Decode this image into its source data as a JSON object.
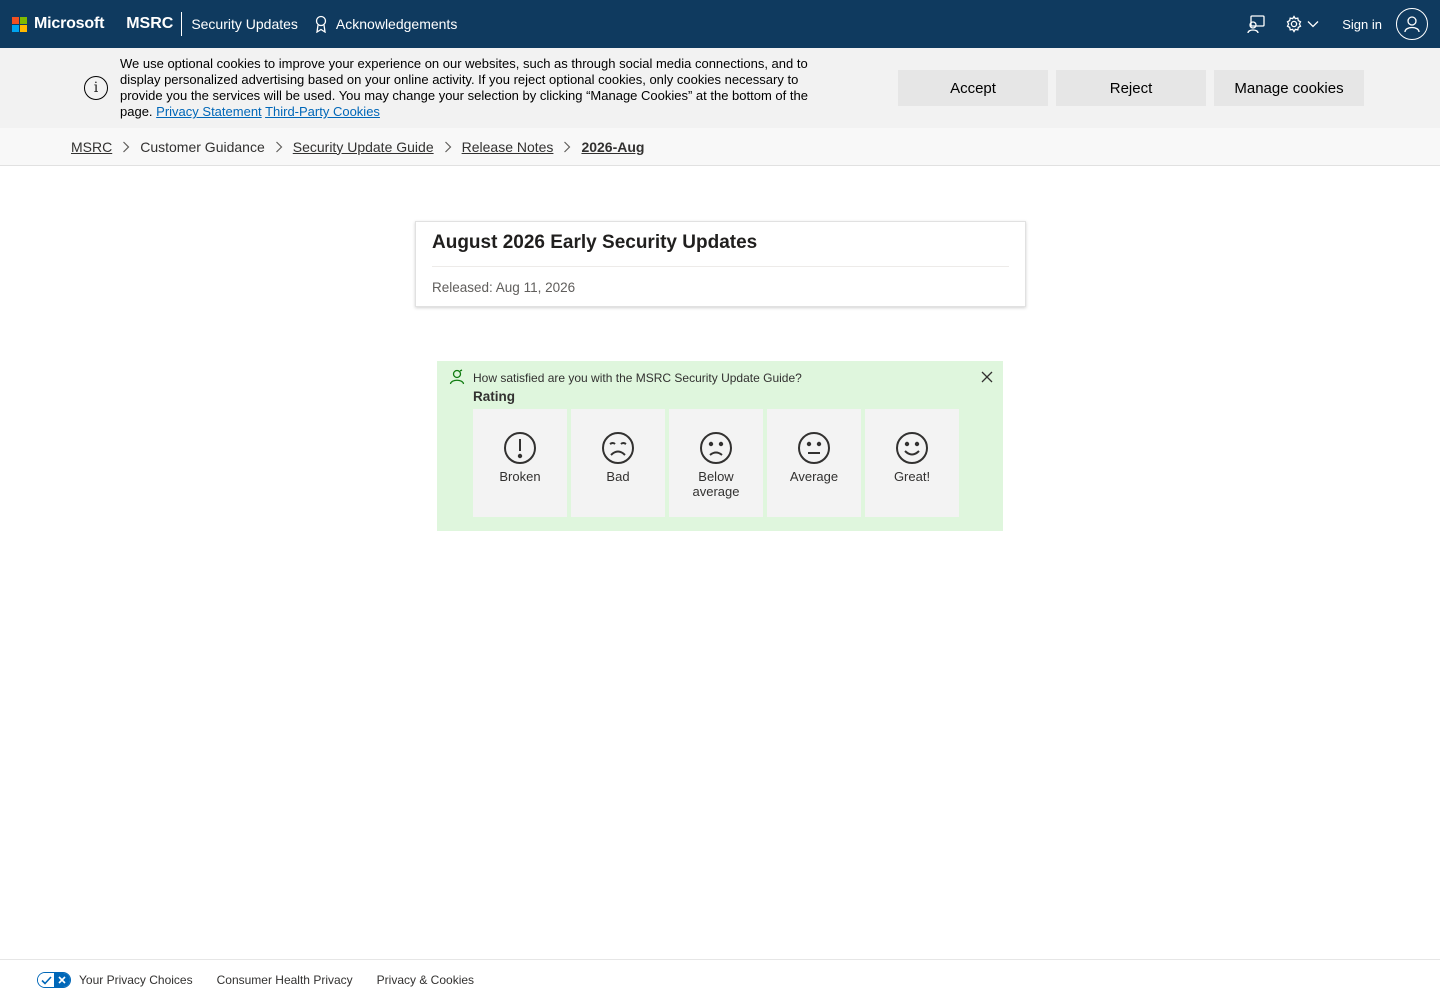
{
  "nav": {
    "brand": "Microsoft",
    "msrc": "MSRC",
    "links": [
      "Security Updates",
      "Acknowledgements"
    ],
    "sign_in": "Sign in",
    "brand_colors": [
      "#f25022",
      "#7fba00",
      "#00a4ef",
      "#ffb900"
    ],
    "background": "#0f3a5f",
    "icons": [
      "feedback-icon",
      "settings-icon",
      "chevron-down-icon",
      "user-icon"
    ]
  },
  "cookie": {
    "text": "We use optional cookies to improve your experience on our websites, such as through social media connections, and to display personalized advertising based on your online activity. If you reject optional cookies, only cookies necessary to provide you the services will be used. You may change your selection by clicking “Manage Cookies” at the bottom of the page.",
    "privacy_link": "Privacy Statement",
    "third_party_link": "Third-Party Cookies",
    "accept": "Accept",
    "reject": "Reject",
    "manage": "Manage cookies"
  },
  "breadcrumb": {
    "items": [
      "MSRC",
      "Customer Guidance",
      "Security Update Guide",
      "Release Notes",
      "2026-Aug"
    ]
  },
  "release": {
    "title": "August 2026 Early Security Updates",
    "released": "Released: Aug 11, 2026"
  },
  "feedback": {
    "question": "How satisfied are you with the MSRC Security Update Guide?",
    "rating_label": "Rating",
    "background": "#dff6dd",
    "options": [
      {
        "label": "Broken",
        "icon": "exclamation-icon"
      },
      {
        "label": "Bad",
        "icon": "sad-face-icon"
      },
      {
        "label": "Below average",
        "icon": "frown-face-icon"
      },
      {
        "label": "Average",
        "icon": "neutral-face-icon"
      },
      {
        "label": "Great!",
        "icon": "smile-face-icon"
      }
    ]
  },
  "footer": {
    "privacy_choices": "Your Privacy Choices",
    "consumer_health": "Consumer Health Privacy",
    "privacy_cookies": "Privacy & Cookies"
  }
}
